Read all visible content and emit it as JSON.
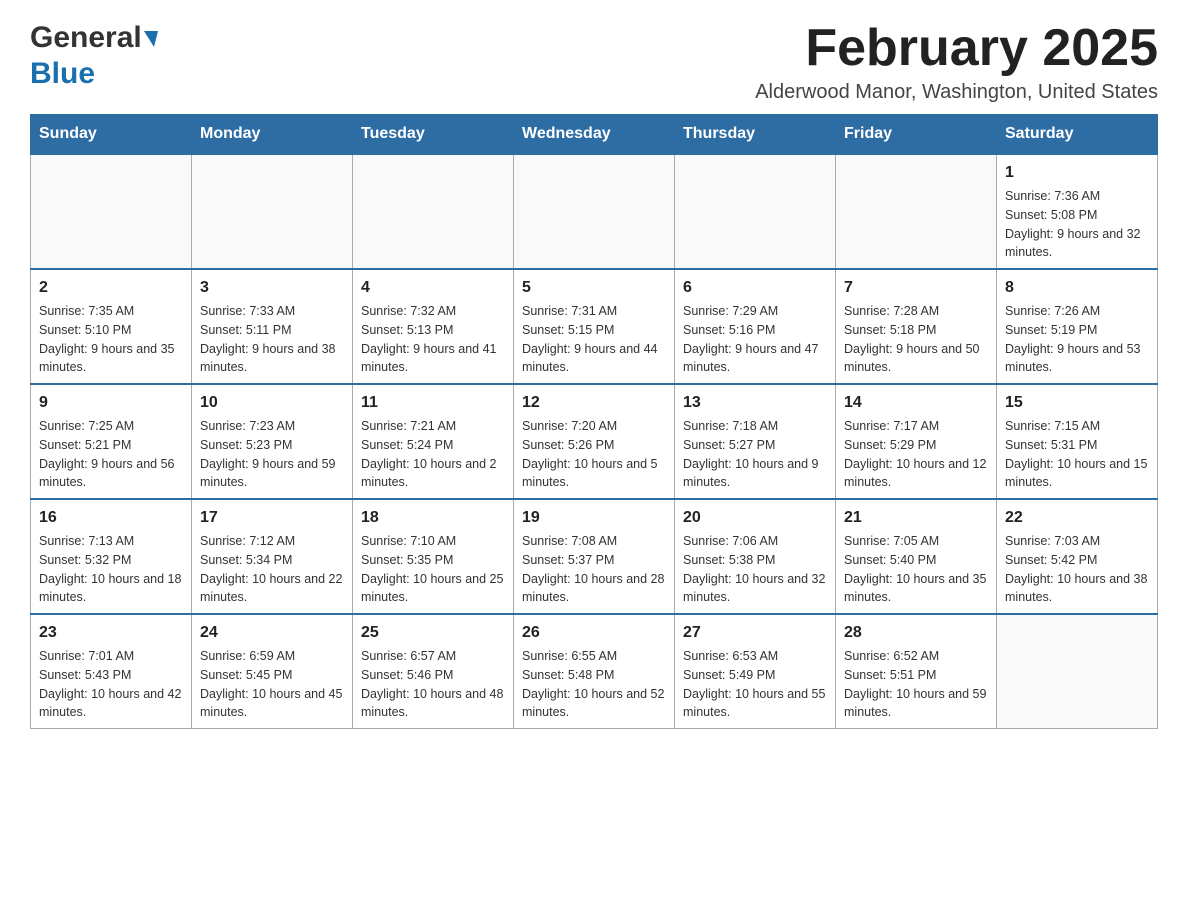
{
  "logo": {
    "general": "General",
    "blue": "Blue"
  },
  "header": {
    "title": "February 2025",
    "subtitle": "Alderwood Manor, Washington, United States"
  },
  "weekdays": [
    "Sunday",
    "Monday",
    "Tuesday",
    "Wednesday",
    "Thursday",
    "Friday",
    "Saturday"
  ],
  "weeks": [
    [
      {
        "day": "",
        "sunrise": "",
        "sunset": "",
        "daylight": ""
      },
      {
        "day": "",
        "sunrise": "",
        "sunset": "",
        "daylight": ""
      },
      {
        "day": "",
        "sunrise": "",
        "sunset": "",
        "daylight": ""
      },
      {
        "day": "",
        "sunrise": "",
        "sunset": "",
        "daylight": ""
      },
      {
        "day": "",
        "sunrise": "",
        "sunset": "",
        "daylight": ""
      },
      {
        "day": "",
        "sunrise": "",
        "sunset": "",
        "daylight": ""
      },
      {
        "day": "1",
        "sunrise": "Sunrise: 7:36 AM",
        "sunset": "Sunset: 5:08 PM",
        "daylight": "Daylight: 9 hours and 32 minutes."
      }
    ],
    [
      {
        "day": "2",
        "sunrise": "Sunrise: 7:35 AM",
        "sunset": "Sunset: 5:10 PM",
        "daylight": "Daylight: 9 hours and 35 minutes."
      },
      {
        "day": "3",
        "sunrise": "Sunrise: 7:33 AM",
        "sunset": "Sunset: 5:11 PM",
        "daylight": "Daylight: 9 hours and 38 minutes."
      },
      {
        "day": "4",
        "sunrise": "Sunrise: 7:32 AM",
        "sunset": "Sunset: 5:13 PM",
        "daylight": "Daylight: 9 hours and 41 minutes."
      },
      {
        "day": "5",
        "sunrise": "Sunrise: 7:31 AM",
        "sunset": "Sunset: 5:15 PM",
        "daylight": "Daylight: 9 hours and 44 minutes."
      },
      {
        "day": "6",
        "sunrise": "Sunrise: 7:29 AM",
        "sunset": "Sunset: 5:16 PM",
        "daylight": "Daylight: 9 hours and 47 minutes."
      },
      {
        "day": "7",
        "sunrise": "Sunrise: 7:28 AM",
        "sunset": "Sunset: 5:18 PM",
        "daylight": "Daylight: 9 hours and 50 minutes."
      },
      {
        "day": "8",
        "sunrise": "Sunrise: 7:26 AM",
        "sunset": "Sunset: 5:19 PM",
        "daylight": "Daylight: 9 hours and 53 minutes."
      }
    ],
    [
      {
        "day": "9",
        "sunrise": "Sunrise: 7:25 AM",
        "sunset": "Sunset: 5:21 PM",
        "daylight": "Daylight: 9 hours and 56 minutes."
      },
      {
        "day": "10",
        "sunrise": "Sunrise: 7:23 AM",
        "sunset": "Sunset: 5:23 PM",
        "daylight": "Daylight: 9 hours and 59 minutes."
      },
      {
        "day": "11",
        "sunrise": "Sunrise: 7:21 AM",
        "sunset": "Sunset: 5:24 PM",
        "daylight": "Daylight: 10 hours and 2 minutes."
      },
      {
        "day": "12",
        "sunrise": "Sunrise: 7:20 AM",
        "sunset": "Sunset: 5:26 PM",
        "daylight": "Daylight: 10 hours and 5 minutes."
      },
      {
        "day": "13",
        "sunrise": "Sunrise: 7:18 AM",
        "sunset": "Sunset: 5:27 PM",
        "daylight": "Daylight: 10 hours and 9 minutes."
      },
      {
        "day": "14",
        "sunrise": "Sunrise: 7:17 AM",
        "sunset": "Sunset: 5:29 PM",
        "daylight": "Daylight: 10 hours and 12 minutes."
      },
      {
        "day": "15",
        "sunrise": "Sunrise: 7:15 AM",
        "sunset": "Sunset: 5:31 PM",
        "daylight": "Daylight: 10 hours and 15 minutes."
      }
    ],
    [
      {
        "day": "16",
        "sunrise": "Sunrise: 7:13 AM",
        "sunset": "Sunset: 5:32 PM",
        "daylight": "Daylight: 10 hours and 18 minutes."
      },
      {
        "day": "17",
        "sunrise": "Sunrise: 7:12 AM",
        "sunset": "Sunset: 5:34 PM",
        "daylight": "Daylight: 10 hours and 22 minutes."
      },
      {
        "day": "18",
        "sunrise": "Sunrise: 7:10 AM",
        "sunset": "Sunset: 5:35 PM",
        "daylight": "Daylight: 10 hours and 25 minutes."
      },
      {
        "day": "19",
        "sunrise": "Sunrise: 7:08 AM",
        "sunset": "Sunset: 5:37 PM",
        "daylight": "Daylight: 10 hours and 28 minutes."
      },
      {
        "day": "20",
        "sunrise": "Sunrise: 7:06 AM",
        "sunset": "Sunset: 5:38 PM",
        "daylight": "Daylight: 10 hours and 32 minutes."
      },
      {
        "day": "21",
        "sunrise": "Sunrise: 7:05 AM",
        "sunset": "Sunset: 5:40 PM",
        "daylight": "Daylight: 10 hours and 35 minutes."
      },
      {
        "day": "22",
        "sunrise": "Sunrise: 7:03 AM",
        "sunset": "Sunset: 5:42 PM",
        "daylight": "Daylight: 10 hours and 38 minutes."
      }
    ],
    [
      {
        "day": "23",
        "sunrise": "Sunrise: 7:01 AM",
        "sunset": "Sunset: 5:43 PM",
        "daylight": "Daylight: 10 hours and 42 minutes."
      },
      {
        "day": "24",
        "sunrise": "Sunrise: 6:59 AM",
        "sunset": "Sunset: 5:45 PM",
        "daylight": "Daylight: 10 hours and 45 minutes."
      },
      {
        "day": "25",
        "sunrise": "Sunrise: 6:57 AM",
        "sunset": "Sunset: 5:46 PM",
        "daylight": "Daylight: 10 hours and 48 minutes."
      },
      {
        "day": "26",
        "sunrise": "Sunrise: 6:55 AM",
        "sunset": "Sunset: 5:48 PM",
        "daylight": "Daylight: 10 hours and 52 minutes."
      },
      {
        "day": "27",
        "sunrise": "Sunrise: 6:53 AM",
        "sunset": "Sunset: 5:49 PM",
        "daylight": "Daylight: 10 hours and 55 minutes."
      },
      {
        "day": "28",
        "sunrise": "Sunrise: 6:52 AM",
        "sunset": "Sunset: 5:51 PM",
        "daylight": "Daylight: 10 hours and 59 minutes."
      },
      {
        "day": "",
        "sunrise": "",
        "sunset": "",
        "daylight": ""
      }
    ]
  ]
}
